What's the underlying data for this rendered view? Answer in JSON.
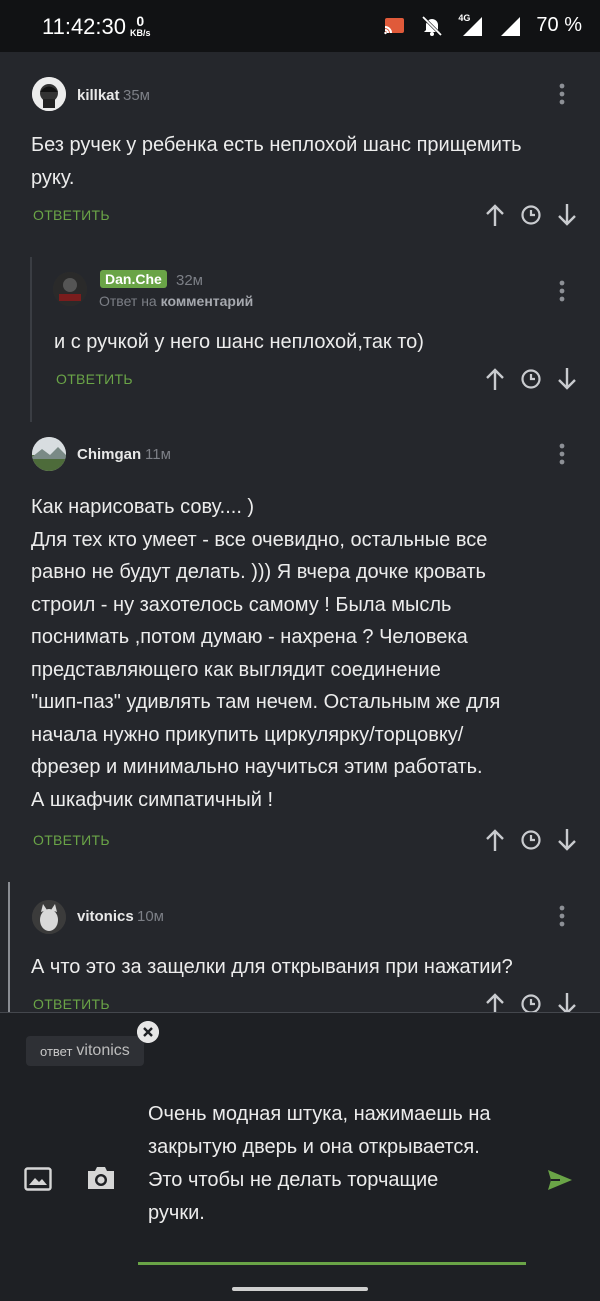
{
  "status_bar": {
    "time": "11:42:30",
    "speed_value": "0",
    "speed_unit": "KB/s",
    "network": "4G",
    "battery": "70 %"
  },
  "comments": [
    {
      "username": "killkat",
      "time": "35м",
      "text_lines": [
        "Без ручек у ребенка есть неплохой шанс прищемить",
        "руку."
      ],
      "reply_label": "ОТВЕТИТЬ"
    },
    {
      "username": "Dan.Che",
      "time": "32м",
      "reply_prefix": "Ответ на",
      "reply_target": "комментарий",
      "text_lines": [
        "и с ручкой у него шанс неплохой,так то)"
      ],
      "reply_label": "ОТВЕТИТЬ"
    },
    {
      "username": "Chimgan",
      "time": "11м",
      "text_lines": [
        "Как нарисовать сову.... )",
        "Для тех кто умеет - все очевидно, остальные все",
        "равно не будут делать. ))) Я вчера дочке кровать",
        "строил - ну захотелось самому ! Была мысль",
        "поснимать ,потом думаю - нахрена ? Человека",
        "представляющего как выглядит соединение",
        "\"шип-паз\" удивлять там нечем. Остальным же для",
        "начала нужно прикупить циркулярку/торцовку/",
        "фрезер и минимально научиться этим работать.",
        "А шкафчик симпатичный !"
      ],
      "reply_label": "ОТВЕТИТЬ"
    },
    {
      "username": "vitonics",
      "time": "10м",
      "text_lines": [
        "А что это за защелки для открывания при нажатии?"
      ],
      "reply_label": "ОТВЕТИТЬ"
    }
  ],
  "reply_box": {
    "chip_prefix": "ответ",
    "chip_name": "vitonics",
    "text_lines": [
      "Очень модная штука, нажимаешь на",
      "закрытую дверь и она открывается.",
      "Это чтобы не делать торчащие",
      "ручки."
    ]
  },
  "colors": {
    "accent_green": "#6aa447",
    "background": "#25272c",
    "muted_text": "#7c7f86"
  },
  "icons": [
    "upvote-icon",
    "history-icon",
    "downvote-icon",
    "more-vertical-icon",
    "image-icon",
    "camera-icon",
    "send-icon",
    "close-icon",
    "cast-icon",
    "mute-icon"
  ]
}
